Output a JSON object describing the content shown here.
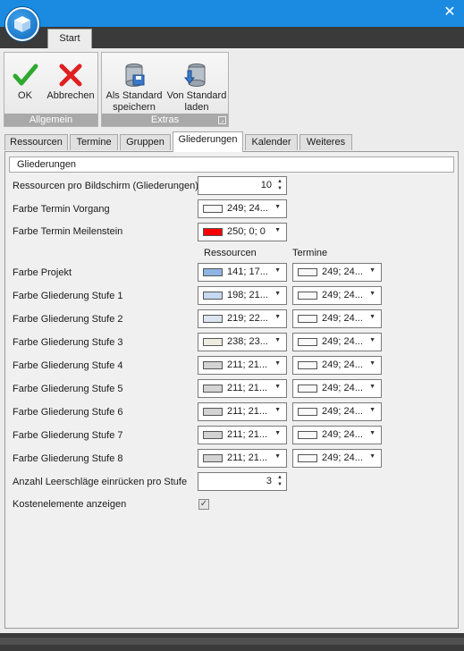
{
  "window": {
    "close_glyph": "✕"
  },
  "ribbon": {
    "tab_start": "Start",
    "groups": {
      "allgemein": "Allgemein",
      "extras": "Extras"
    },
    "buttons": {
      "ok": "OK",
      "abbrechen": "Abbrechen",
      "als_standard_1": "Als Standard",
      "als_standard_2": "speichern",
      "von_standard_1": "Von Standard",
      "von_standard_2": "laden"
    }
  },
  "tabs": [
    "Ressourcen",
    "Termine",
    "Gruppen",
    "Gliederungen",
    "Kalender",
    "Weiteres"
  ],
  "active_tab": "Gliederungen",
  "section": {
    "title": "Gliederungen",
    "ressourcen_pro_bildschirm": {
      "label": "Ressourcen pro Bildschirm (Gliederungen)",
      "value": "10"
    },
    "farbe_termin_vorgang": {
      "label": "Farbe Termin Vorgang",
      "text": "249; 24...",
      "color": "#f9f9f9"
    },
    "farbe_termin_meilenstein": {
      "label": "Farbe Termin Meilenstein",
      "text": "250; 0; 0",
      "color": "#fa0000"
    },
    "col_ressourcen": "Ressourcen",
    "col_termine": "Termine",
    "rows": [
      {
        "label": "Farbe Projekt",
        "res_text": "141; 17...",
        "res_color": "#8db4e2",
        "ter_text": "249; 24...",
        "ter_color": "#f9f9f9"
      },
      {
        "label": "Farbe Gliederung Stufe 1",
        "res_text": "198; 21...",
        "res_color": "#c6d9f0",
        "ter_text": "249; 24...",
        "ter_color": "#f9f9f9"
      },
      {
        "label": "Farbe Gliederung Stufe 2",
        "res_text": "219; 22...",
        "res_color": "#dbe5f1",
        "ter_text": "249; 24...",
        "ter_color": "#f9f9f9"
      },
      {
        "label": "Farbe Gliederung Stufe 3",
        "res_text": "238; 23...",
        "res_color": "#eeece1",
        "ter_text": "249; 24...",
        "ter_color": "#f9f9f9"
      },
      {
        "label": "Farbe Gliederung Stufe 4",
        "res_text": "211; 21...",
        "res_color": "#d3d3d3",
        "ter_text": "249; 24...",
        "ter_color": "#f9f9f9"
      },
      {
        "label": "Farbe Gliederung Stufe 5",
        "res_text": "211; 21...",
        "res_color": "#d3d3d3",
        "ter_text": "249; 24...",
        "ter_color": "#f9f9f9"
      },
      {
        "label": "Farbe Gliederung Stufe 6",
        "res_text": "211; 21...",
        "res_color": "#d3d3d3",
        "ter_text": "249; 24...",
        "ter_color": "#f9f9f9"
      },
      {
        "label": "Farbe Gliederung Stufe 7",
        "res_text": "211; 21...",
        "res_color": "#d3d3d3",
        "ter_text": "249; 24...",
        "ter_color": "#f9f9f9"
      },
      {
        "label": "Farbe Gliederung Stufe 8",
        "res_text": "211; 21...",
        "res_color": "#d3d3d3",
        "ter_text": "249; 24...",
        "ter_color": "#f9f9f9"
      }
    ],
    "anzahl_leerschlaege": {
      "label": "Anzahl Leerschläge einrücken pro Stufe",
      "value": "3"
    },
    "kostenelemente": {
      "label": "Kostenelemente anzeigen",
      "checked": true,
      "glyph": "✓"
    }
  }
}
